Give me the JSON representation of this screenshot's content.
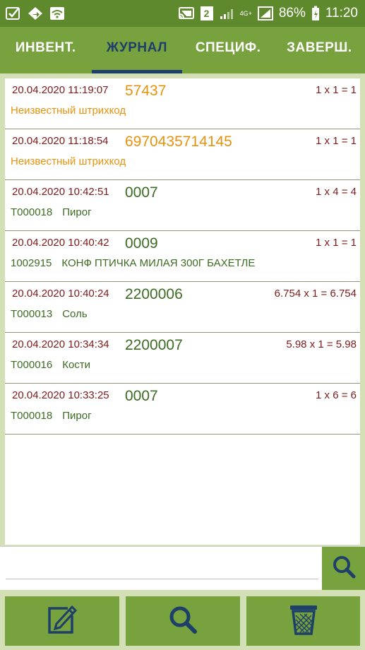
{
  "status_bar": {
    "network_badge": "2",
    "network_type": "4G+",
    "battery": "86%",
    "time": "11:20"
  },
  "tabs": [
    {
      "label": "ИНВЕНТ.",
      "active": false
    },
    {
      "label": "ЖУРНАЛ",
      "active": true
    },
    {
      "label": "СПЕЦИФ.",
      "active": false
    },
    {
      "label": "ЗАВЕРШ.",
      "active": false
    }
  ],
  "journal": [
    {
      "timestamp": "20.04.2020 11:19:07",
      "barcode": "57437",
      "calc": "1 x 1 = 1",
      "article": "",
      "name": "Неизвестный штрихкод",
      "unknown": true
    },
    {
      "timestamp": "20.04.2020 11:18:54",
      "barcode": "6970435714145",
      "calc": "1 x 1 = 1",
      "article": "",
      "name": "Неизвестный штрихкод",
      "unknown": true
    },
    {
      "timestamp": "20.04.2020 10:42:51",
      "barcode": "0007",
      "calc": "1 x 4 = 4",
      "article": "Т000018",
      "name": "Пирог",
      "unknown": false
    },
    {
      "timestamp": "20.04.2020 10:40:42",
      "barcode": "0009",
      "calc": "1 x 1 = 1",
      "article": "1002915",
      "name": "КОНФ ПТИЧКА МИЛАЯ 300Г БАХЕТЛЕ",
      "unknown": false
    },
    {
      "timestamp": "20.04.2020 10:40:24",
      "barcode": "2200006",
      "calc": "6.754 x 1 = 6.754",
      "article": "Т000013",
      "name": "Соль",
      "unknown": false
    },
    {
      "timestamp": "20.04.2020 10:34:34",
      "barcode": "2200007",
      "calc": "5.98 x 1 = 5.98",
      "article": "Т000016",
      "name": "Кости",
      "unknown": false
    },
    {
      "timestamp": "20.04.2020 10:33:25",
      "barcode": "0007",
      "calc": "1 x 6 = 6",
      "article": "Т000018",
      "name": "Пирог",
      "unknown": false
    }
  ],
  "search": {
    "value": "",
    "button_icon": "search-icon"
  },
  "actions": [
    {
      "icon": "edit-icon"
    },
    {
      "icon": "search-icon"
    },
    {
      "icon": "trash-icon"
    }
  ],
  "colors": {
    "header_green": "#77a23e",
    "status_green": "#5e8a2d",
    "active_tab_navy": "#1f3f6b",
    "timestamp_red": "#7b1a1a",
    "unknown_orange": "#e8920c",
    "known_green": "#3c6b22",
    "background": "#d3dfb4"
  }
}
